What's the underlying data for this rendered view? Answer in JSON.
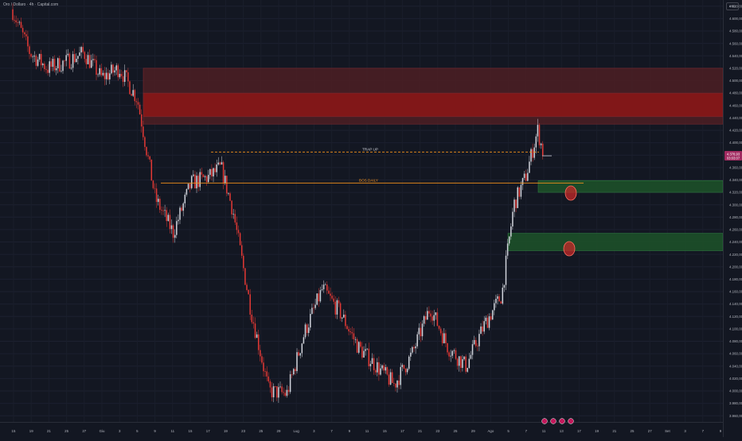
{
  "header": {
    "title": "Oro / Dollaro · 4h · Capital.com",
    "currency": "USD"
  },
  "annotations": {
    "trap_label": "TRAP UP",
    "bos_label": "BOS DAILY"
  },
  "price_axis": {
    "labels": [
      "4.620,00",
      "4.600,00",
      "4.580,00",
      "4.560,00",
      "4.540,00",
      "4.520,00",
      "4.500,00",
      "4.480,00",
      "4.460,00",
      "4.440,00",
      "4.420,00",
      "4.400,00",
      "4.380,00",
      "4.360,00",
      "4.340,00",
      "4.320,00",
      "4.300,00",
      "4.280,00",
      "4.260,00",
      "4.240,00",
      "4.220,00",
      "4.200,00",
      "4.180,00",
      "4.160,00",
      "4.140,00",
      "4.120,00",
      "4.100,00",
      "4.080,00",
      "4.060,00",
      "4.040,00",
      "4.020,00",
      "4.000,00",
      "3.980,00",
      "3.960,00"
    ],
    "current_price": "4.378,93",
    "countdown": "03:03:07"
  },
  "time_axis": {
    "labels": [
      "15",
      "19",
      "21",
      "25",
      "27",
      "Giu",
      "3",
      "5",
      "9",
      "11",
      "15",
      "17",
      "19",
      "23",
      "25",
      "29",
      "Lug",
      "3",
      "7",
      "9",
      "11",
      "15",
      "17",
      "21",
      "23",
      "25",
      "29",
      "Ago",
      "5",
      "7",
      "11",
      "13",
      "17",
      "19",
      "21",
      "25",
      "27",
      "Set",
      "3",
      "7",
      "9"
    ]
  },
  "colors": {
    "background": "#131722",
    "up_candle": "#d1d4dc",
    "down_candle": "#e53935",
    "supply_zone": "#8f1a1a",
    "demand_zone": "#1e5a2c",
    "bos_line": "#f7931a",
    "price_badge": "#a22b61"
  },
  "chart_data": {
    "type": "candlestick",
    "title": "Oro / Dollaro · 4h · Capital.com",
    "ylim": [
      3950,
      4630
    ],
    "x": [
      "2025-05-14",
      "2025-05-17",
      "2025-05-20",
      "2025-05-23",
      "2025-05-26",
      "2025-05-29",
      "2025-06-01",
      "2025-06-04",
      "2025-06-07",
      "2025-06-10",
      "2025-06-13",
      "2025-06-16",
      "2025-06-18",
      "2025-06-20",
      "2025-06-23",
      "2025-06-26",
      "2025-06-29",
      "2025-07-02",
      "2025-07-05",
      "2025-07-08",
      "2025-07-11",
      "2025-07-14",
      "2025-07-17",
      "2025-07-20",
      "2025-07-23",
      "2025-07-26",
      "2025-07-29",
      "2025-08-01",
      "2025-08-04",
      "2025-08-06",
      "2025-08-08",
      "2025-08-10",
      "2025-08-11"
    ],
    "close": [
      4615,
      4545,
      4520,
      4530,
      4545,
      4505,
      4520,
      4470,
      4310,
      4255,
      4335,
      4345,
      4360,
      4290,
      4130,
      4000,
      3995,
      4095,
      4165,
      4125,
      4070,
      4040,
      4010,
      4060,
      4135,
      4070,
      4040,
      4105,
      4155,
      4300,
      4345,
      4420,
      4380
    ],
    "price_levels": [
      {
        "label": "TRAP UP",
        "price": 4385,
        "style": "dashed"
      },
      {
        "label": "BOS DAILY",
        "price": 4335,
        "style": "solid"
      }
    ],
    "zones": [
      {
        "kind": "supply",
        "from": 4430,
        "to": 4520
      },
      {
        "kind": "supply",
        "from": 4442,
        "to": 4480
      },
      {
        "kind": "demand",
        "from": 4320,
        "to": 4339
      },
      {
        "kind": "demand",
        "from": 4226,
        "to": 4254
      }
    ]
  }
}
